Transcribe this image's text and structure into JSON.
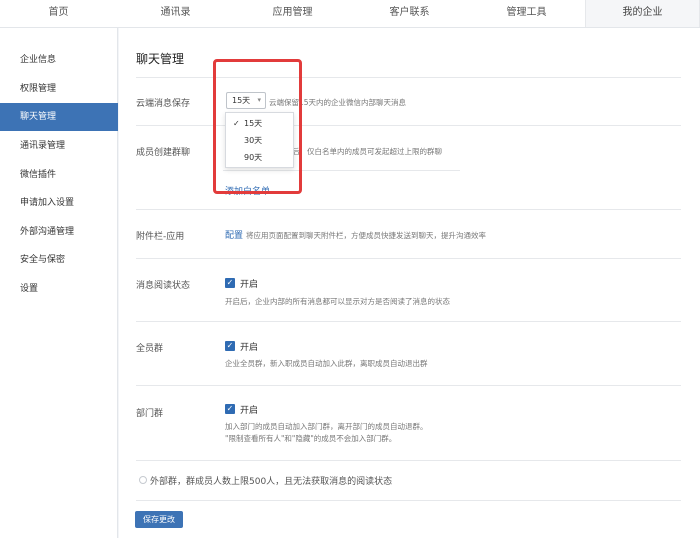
{
  "nav": {
    "tabs": [
      "首页",
      "通讯录",
      "应用管理",
      "客户联系",
      "管理工具",
      "我的企业"
    ],
    "active": "我的企业"
  },
  "sidebar": {
    "items": [
      {
        "label": "企业信息"
      },
      {
        "label": "权限管理"
      },
      {
        "label": "聊天管理"
      },
      {
        "label": "通讯录管理"
      },
      {
        "label": "微信插件"
      },
      {
        "label": "申请加入设置"
      },
      {
        "label": "外部沟通管理"
      },
      {
        "label": "安全与保密"
      },
      {
        "label": "设置"
      }
    ],
    "active": "聊天管理"
  },
  "main": {
    "title": "聊天管理",
    "cloud_storage": {
      "label": "云端消息保存",
      "selected": "15天",
      "desc": "云端保留15天内的企业微信内部聊天消息",
      "options": [
        "15天",
        "30天",
        "90天"
      ]
    },
    "group_create": {
      "label": "成员创建群聊",
      "desc": "设置后，仅白名单内的成员可发起超过上限的群聊",
      "add_link": "添加白名单"
    },
    "attachment": {
      "label": "附件栏-应用",
      "link": "配置",
      "desc": "将应用页面配置到聊天附件栏，方便成员快捷发送到聊天，提升沟通效率"
    },
    "read_status": {
      "label": "消息阅读状态",
      "checkbox": "开启",
      "desc": "开启后，企业内部的所有消息都可以显示对方是否阅读了消息的状态"
    },
    "all_group": {
      "label": "全员群",
      "checkbox": "开启",
      "desc": "企业全员群，新入职成员自动加入此群，离职成员自动退出群"
    },
    "dept_group": {
      "label": "部门群",
      "checkbox": "开启",
      "desc1": "加入部门的成员自动加入部门群，离开部门的成员自动退群。",
      "desc2": "\"限制查看所有人\"和\"隐藏\"的成员不会加入部门群。"
    },
    "external": {
      "label": "外部群，群成员人数上限500人，且无法获取消息的阅读状态"
    },
    "save_button": "保存更改"
  },
  "colors": {
    "accent": "#3d73b5",
    "link": "#2f6bb3",
    "highlight": "#e23b3b"
  }
}
